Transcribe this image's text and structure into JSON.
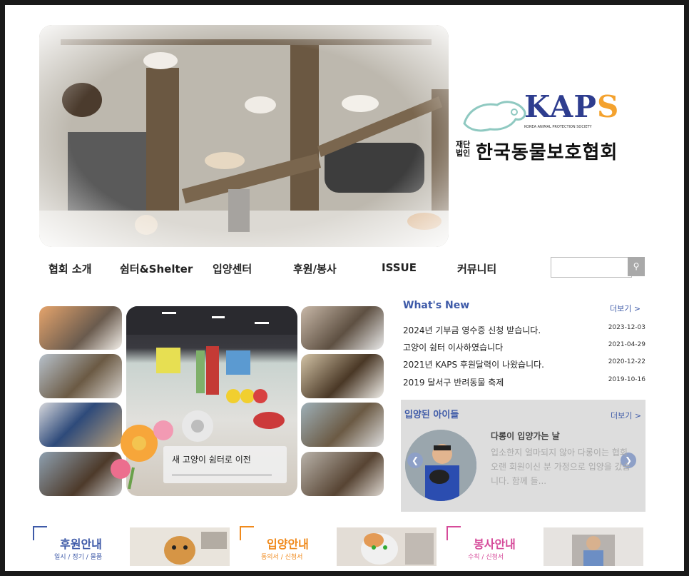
{
  "brand": {
    "logo_text_primary": "KAP",
    "logo_text_accent": "S",
    "logo_subtitle": "KOREA ANIMAL PROTECTION SOCIETY",
    "org_prefix": "재단법인",
    "org_name": "한국동물보호협회"
  },
  "nav": {
    "items": [
      "협회 소개",
      "쉼터&Shelter",
      "입양센터",
      "후원/봉사",
      "ISSUE",
      "커뮤니티"
    ]
  },
  "search": {
    "placeholder": "",
    "button_icon": "search-icon"
  },
  "gallery": {
    "caption": "새 고양이 쉼터로 이전"
  },
  "whats_new": {
    "title": "What's New",
    "more_label": "더보기 >",
    "items": [
      {
        "text": "2024년 기부금 영수증 신청 받습니다.",
        "date": "2023-12-03"
      },
      {
        "text": "고양이 쉼터 이사하였습니다",
        "date": "2021-04-29"
      },
      {
        "text": "2021년 KAPS 후원달력이 나왔습니다.",
        "date": "2020-12-22"
      },
      {
        "text": "2019 달서구 반려동물 축제",
        "date": "2019-10-16"
      }
    ]
  },
  "adopted": {
    "title": "입양된 아이들",
    "more_label": "더보기 >",
    "story_title": "다롱이 입양가는 날",
    "story_text": "입소한지 얼마되지 않아 다롱이는 협회 오랜 회원이신 분 가정으로 입양을 갔습니다. 함께 들..."
  },
  "banners": [
    {
      "title": "후원안내",
      "sub": "일시 / 정기 / 물품",
      "color": "#3e5aa8"
    },
    {
      "title": "입양안내",
      "sub": "동의서 / 신청서",
      "color": "#f08a1c"
    },
    {
      "title": "봉사안내",
      "sub": "수칙 / 신청서",
      "color": "#d64b9a"
    }
  ]
}
